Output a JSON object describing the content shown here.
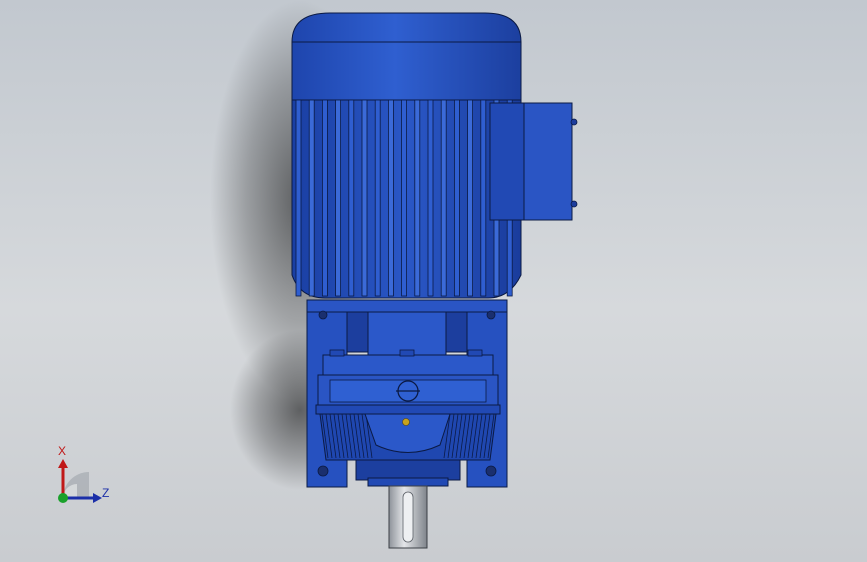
{
  "viewport": {
    "background_top": "#c2c8cf",
    "background_bottom": "#c9ccd0"
  },
  "model": {
    "body_color": "#2a55c4",
    "body_dark": "#173a97",
    "body_light": "#3b6ad8",
    "edge_color": "#0b1a44",
    "shaft_color": "#c4c7cc"
  },
  "triad": {
    "x_label": "X",
    "z_label": "Z",
    "x_color": "#c01818",
    "z_color": "#1b2fa8",
    "y_color": "#1aa12b"
  }
}
